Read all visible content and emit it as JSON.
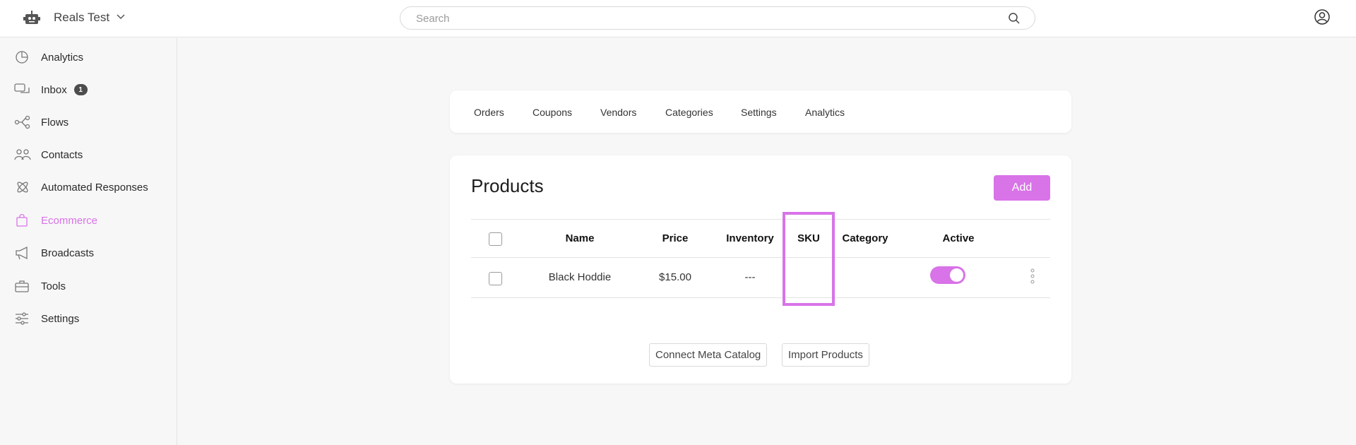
{
  "header": {
    "workspace_name": "Reals Test",
    "search_placeholder": "Search"
  },
  "sidebar": {
    "items": [
      {
        "label": "Analytics",
        "icon": "pie-chart-icon"
      },
      {
        "label": "Inbox",
        "icon": "chat-icon",
        "badge": "1"
      },
      {
        "label": "Flows",
        "icon": "flow-icon"
      },
      {
        "label": "Contacts",
        "icon": "contacts-icon"
      },
      {
        "label": "Automated Responses",
        "icon": "atom-icon"
      },
      {
        "label": "Ecommerce",
        "icon": "shopping-bag-icon",
        "active": true
      },
      {
        "label": "Broadcasts",
        "icon": "megaphone-icon"
      },
      {
        "label": "Tools",
        "icon": "toolbox-icon"
      },
      {
        "label": "Settings",
        "icon": "sliders-icon"
      }
    ]
  },
  "tabs": [
    "Orders",
    "Coupons",
    "Vendors",
    "Categories",
    "Settings",
    "Analytics"
  ],
  "products": {
    "title": "Products",
    "add_label": "Add",
    "columns": [
      "Name",
      "Price",
      "Inventory",
      "SKU",
      "Category",
      "Active"
    ],
    "rows": [
      {
        "name": "Black Hoddie",
        "price": "$15.00",
        "inventory": "---",
        "sku": "",
        "category": "",
        "active": true
      }
    ],
    "connect_label": "Connect Meta Catalog",
    "import_label": "Import Products"
  },
  "colors": {
    "accent": "#d873e8",
    "badge": "#4d4d4d"
  }
}
